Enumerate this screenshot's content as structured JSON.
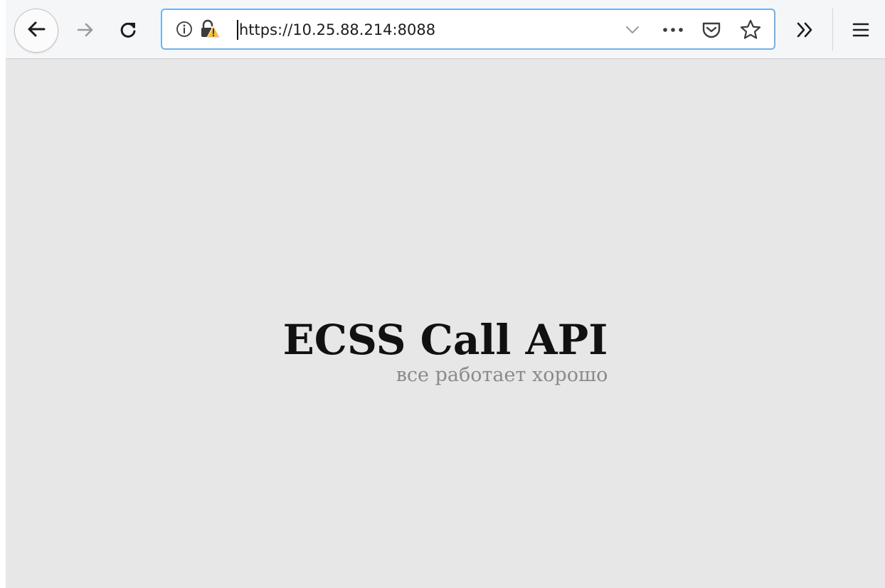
{
  "browser": {
    "url": "https://10.25.88.214:8088",
    "icons": {
      "back": "back-arrow-icon",
      "forward": "forward-arrow-icon",
      "reload": "reload-icon",
      "site_info": "info-icon",
      "connection": "lock-warning-icon",
      "url_dropdown": "chevron-down-icon",
      "page_actions": "more-horizontal-icon",
      "pocket": "pocket-icon",
      "bookmark": "star-icon",
      "overflow": "double-chevron-right-icon",
      "menu": "hamburger-menu-icon"
    }
  },
  "page": {
    "title": "ECSS Call API",
    "subtitle": "все работает хорошо"
  },
  "colors": {
    "toolbar_bg": "#f5f6f7",
    "urlbar_border": "#74b0e8",
    "page_bg": "#e7e7e7",
    "title_color": "#111111",
    "subtitle_color": "#8a8a8a",
    "warning_yellow": "#ffbd2e"
  }
}
